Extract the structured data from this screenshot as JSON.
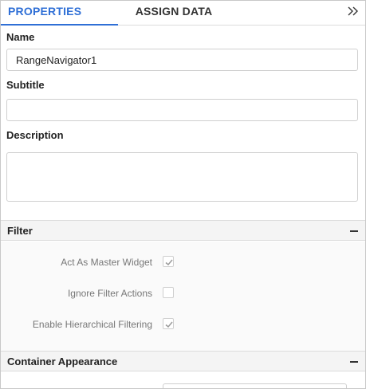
{
  "tabs": {
    "properties": "PROPERTIES",
    "assign_data": "ASSIGN DATA"
  },
  "fields": {
    "name_label": "Name",
    "name_value": "RangeNavigator1",
    "subtitle_label": "Subtitle",
    "subtitle_value": "",
    "description_label": "Description",
    "description_value": ""
  },
  "filter": {
    "title": "Filter",
    "options": [
      {
        "label": "Act As Master Widget",
        "checked": true
      },
      {
        "label": "Ignore Filter Actions",
        "checked": false
      },
      {
        "label": "Enable Hierarchical Filtering",
        "checked": true
      }
    ]
  },
  "container_appearance": {
    "title": "Container Appearance"
  },
  "colors": {
    "accent": "#2f6fd6",
    "check": "#9a9a9a"
  },
  "icons": {
    "collapse": "double-chevron-right-icon",
    "section_toggle": "minus-icon",
    "check": "check-icon"
  }
}
